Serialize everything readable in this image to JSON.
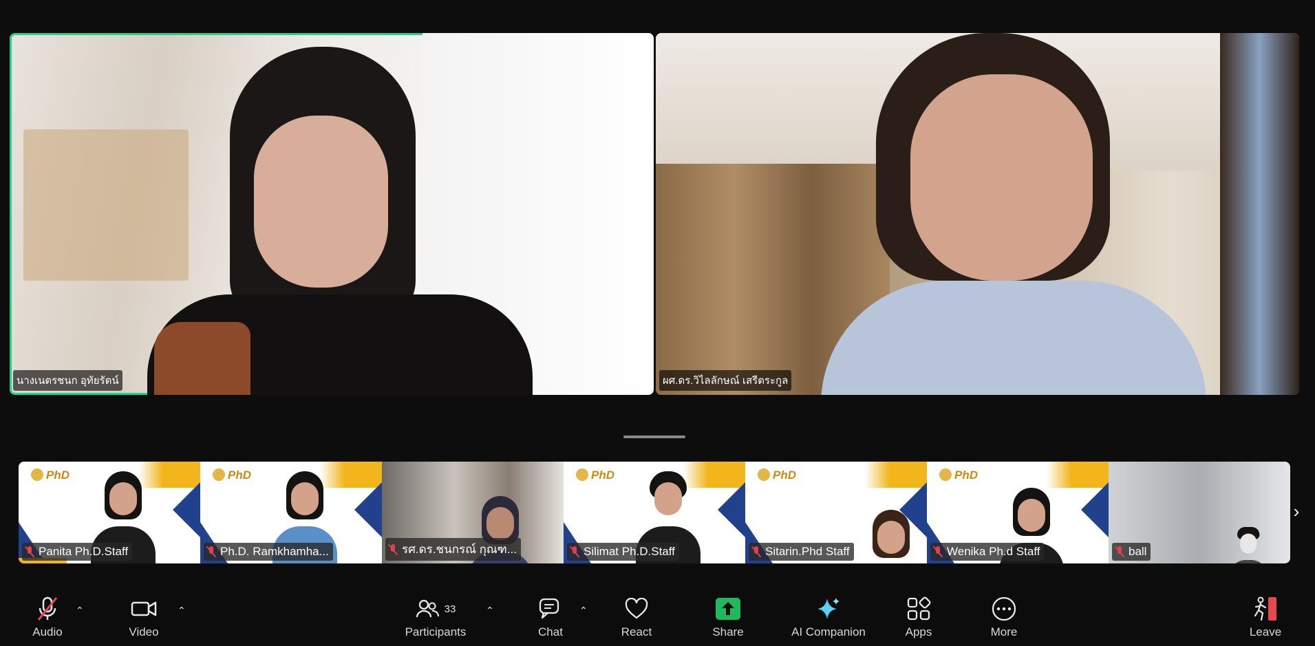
{
  "main_tiles": [
    {
      "name": "นางเนตรชนก อุทัยรัตน์"
    },
    {
      "name": "ผศ.ดร.วิไลลักษณ์ เสรีตระกูล"
    }
  ],
  "strip": {
    "thumb_logo": "PhD",
    "participants": [
      {
        "name": "Panita Ph.D.Staff"
      },
      {
        "name": "Ph.D. Ramkhamha..."
      },
      {
        "name": "รศ.ดร.ชนกรณ์ กุณฑ..."
      },
      {
        "name": "Silimat Ph.D.Staff"
      },
      {
        "name": "Sitarin.Phd Staff"
      },
      {
        "name": "Wenika Ph.d Staff"
      },
      {
        "name": "ball"
      }
    ]
  },
  "toolbar": {
    "audio": "Audio",
    "video": "Video",
    "participants": "Participants",
    "participants_count": "33",
    "chat": "Chat",
    "react": "React",
    "share": "Share",
    "ai_companion": "AI Companion",
    "apps": "Apps",
    "more": "More",
    "leave": "Leave"
  },
  "icons": {
    "audio": "mic-muted-icon",
    "video": "video-camera-icon",
    "participants": "people-icon",
    "chat": "chat-bubble-icon",
    "react": "heart-icon",
    "share": "share-arrow-icon",
    "ai_companion": "sparkle-icon",
    "apps": "apps-icon",
    "more": "more-dots-icon",
    "leave": "leave-door-icon",
    "next": "chevron-right-icon"
  },
  "colors": {
    "active_speaker_border": "#23d18b",
    "share_green": "#1fb85c",
    "muted_red": "#e0414b",
    "leave_red": "#e5484d"
  }
}
